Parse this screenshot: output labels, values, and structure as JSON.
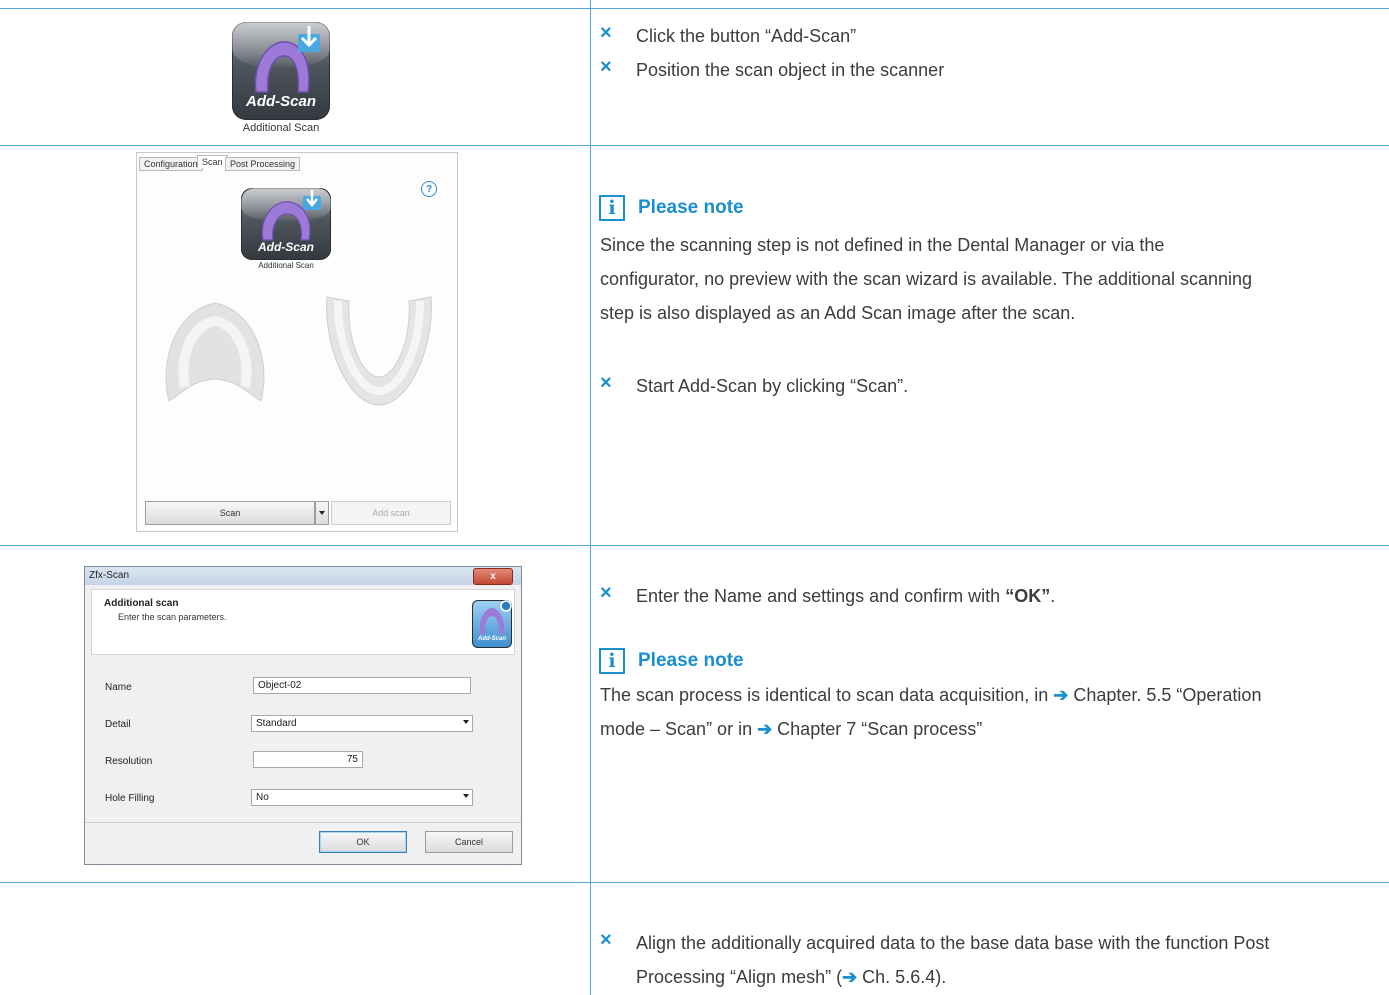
{
  "rows": {
    "r1": {
      "icon_text": "Add-Scan",
      "icon_caption": "Additional Scan",
      "bullets": [
        "Click the button “Add-Scan”",
        "Position the scan object in the scanner"
      ]
    },
    "r2": {
      "tabs": [
        "Configuration",
        "Scan",
        "Post Processing"
      ],
      "help_glyph": "?",
      "icon_text": "Add-Scan",
      "icon_caption": "Additional Scan",
      "scan_button": "Scan",
      "add_scan_button": "Add scan",
      "note_title": "Please note",
      "note_lines": [
        "Since the scanning step is not defined in the Dental Manager or via the",
        "configurator, no preview with the scan wizard is available. The additional scanning",
        "step is also displayed as an Add Scan image after the scan."
      ],
      "bullet": "Start Add-Scan by clicking “Scan”."
    },
    "r3": {
      "dialog_title": "Zfx-Scan",
      "close_glyph": "x",
      "heading": "Additional scan",
      "subheading": "Enter the scan parameters.",
      "corner_icon_text": "Add-Scan",
      "labels": {
        "name": "Name",
        "detail": "Detail",
        "resolution": "Resolution",
        "hole_filling": "Hole Filling"
      },
      "values": {
        "name": "Object-02",
        "detail": "Standard",
        "resolution": "75",
        "hole_filling": "No"
      },
      "ok_button": "OK",
      "cancel_button": "Cancel",
      "bullet_pre": "Enter the Name and settings and confirm with ",
      "bullet_bold": "“OK”",
      "bullet_post": ".",
      "note_title": "Please note",
      "note_line1_pre": "The scan process is identical to scan data acquisition, in ",
      "note_line1_post": " Chapter. 5.5 “Operation",
      "note_line2_pre": "mode – Scan” or in ",
      "note_line2_post": " Chapter 7 “Scan process”"
    },
    "r4": {
      "line1": "Align the additionally acquired data to the base data base with the function Post",
      "line2_pre": "Processing “Align mesh” (",
      "line2_post": " Ch. 5.6.4)."
    }
  },
  "bullet_glyph": "×",
  "arrow_glyph": "➔",
  "note_icon_glyph": "i",
  "colors": {
    "accent": "#1a8fd0",
    "rule": "#4fa7d6",
    "text": "#3c3c3c"
  }
}
